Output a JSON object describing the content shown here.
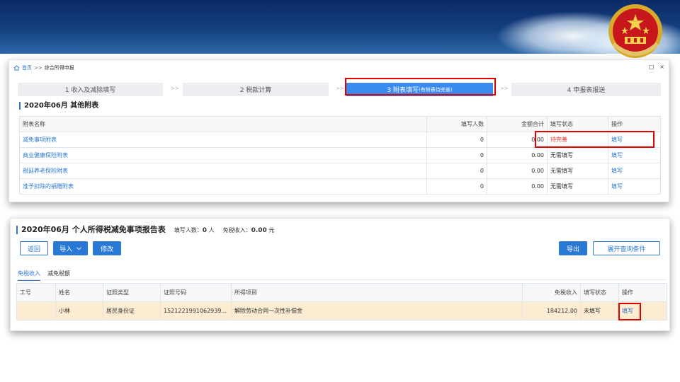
{
  "breadcrumb": {
    "home": "首页",
    "sep": ">>",
    "current": "综合所得申报"
  },
  "window_controls": {
    "restore": "□",
    "close": "×"
  },
  "steps": [
    {
      "label": "1 收入及减除填写",
      "active": false
    },
    {
      "label": "2 税款计算",
      "active": false
    },
    {
      "label": "3 附表填写",
      "note": "(有附表待完善)",
      "active": true
    },
    {
      "label": "4 申报表报送",
      "active": false
    }
  ],
  "step_arrow": ">>",
  "attachments": {
    "title": "2020年06月  其他附表",
    "columns": [
      "附表名称",
      "填写人数",
      "金额合计",
      "填写状态",
      "操作"
    ],
    "rows": [
      {
        "name": "减免事项附表",
        "count": "0",
        "amount": "0.00",
        "status": "待完善",
        "action": "填写"
      },
      {
        "name": "商业健康保险附表",
        "count": "0",
        "amount": "0.00",
        "status": "无需填写",
        "action": "填写"
      },
      {
        "name": "税延养老保险附表",
        "count": "0",
        "amount": "0.00",
        "status": "无需填写",
        "action": "填写"
      },
      {
        "name": "准予扣除的捐赠附表",
        "count": "0",
        "amount": "0.00",
        "status": "无需填写",
        "action": "填写"
      }
    ]
  },
  "report": {
    "title": "2020年06月  个人所得税减免事项报告表",
    "count_label": "填写人数：",
    "count_value": "0",
    "count_unit": "人",
    "income_label": "免税收入：",
    "income_value": "0.00",
    "income_unit": "元",
    "buttons": {
      "back": "返回",
      "import": "导入",
      "edit": "修改",
      "export": "导出",
      "expand": "展开查询条件"
    },
    "tabs": [
      "免税收入",
      "减免税额"
    ],
    "columns": [
      "工号",
      "姓名",
      "证照类型",
      "证照号码",
      "所得项目",
      "免税收入",
      "填写状态",
      "操作"
    ],
    "rows": [
      {
        "id": "",
        "name": "小林",
        "id_type": "居民身份证",
        "id_number": "1521221991062939...",
        "item": "解除劳动合同一次性补偿金",
        "income": "184212.00",
        "status": "未填写",
        "action": "填写"
      }
    ]
  },
  "colors": {
    "accent": "#2a78d5",
    "active_step": "#3a8bf0",
    "highlight": "#e10000",
    "row_highlight": "#fbecd2",
    "banner": "#0b2a66"
  }
}
